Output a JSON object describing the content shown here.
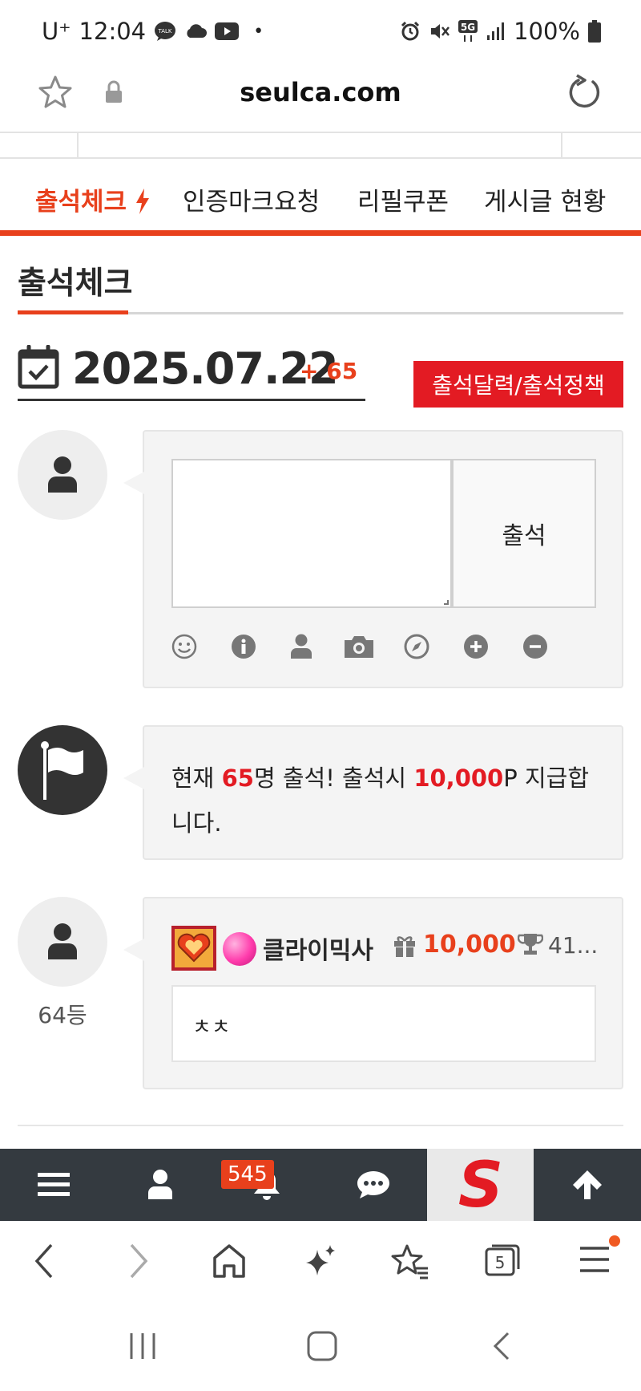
{
  "status_bar": {
    "carrier": "U⁺",
    "time": "12:04",
    "talk_label": "TALK",
    "network": "5G",
    "battery": "100%"
  },
  "browser": {
    "url": "seulca.com"
  },
  "tabs": [
    {
      "label": "출석체크"
    },
    {
      "label": "인증마크요청"
    },
    {
      "label": "리필쿠폰"
    },
    {
      "label": "게시글 현황"
    }
  ],
  "page": {
    "title": "출석체크",
    "date": "2025.07.22",
    "count": "+ 65",
    "policy_button": "출석달력/출석정책"
  },
  "composer": {
    "submit_label": "출석",
    "tools": [
      "smile-icon",
      "info-icon",
      "user-icon",
      "camera-icon",
      "compass-icon",
      "plus-circle-icon",
      "minus-circle-icon"
    ]
  },
  "notice": {
    "prefix": "현재 ",
    "count": "65",
    "mid": "명 출석! 출석시 ",
    "points": "10,000",
    "suffix": "P 지급합니다."
  },
  "entry": {
    "username": "클라이믹사",
    "points": "10,000",
    "trophy": "41...",
    "comment": "ㅊㅊ",
    "rank": "64등"
  },
  "site_bar": {
    "notification_count": "545",
    "logo_letter": "S"
  },
  "browser_nav": {
    "tab_count": "5"
  },
  "colors": {
    "accent": "#e8401c",
    "red": "#e31b23",
    "dark_bar": "#343a40"
  }
}
